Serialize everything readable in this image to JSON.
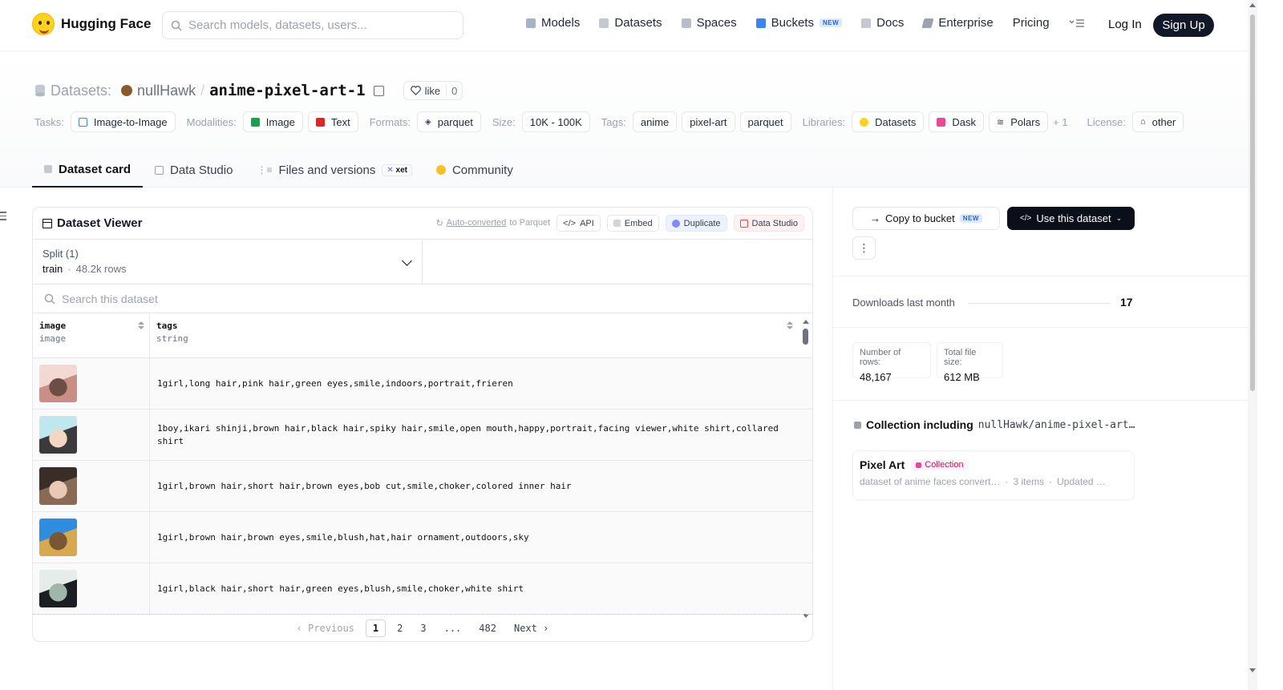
{
  "nav": {
    "brand": "Hugging Face",
    "search_placeholder": "Search models, datasets, users...",
    "links": [
      {
        "label": "Models",
        "icon": "models-icon"
      },
      {
        "label": "Datasets",
        "icon": "datasets-icon"
      },
      {
        "label": "Spaces",
        "icon": "spaces-icon"
      },
      {
        "label": "Buckets",
        "icon": "buckets-icon",
        "badge": "NEW"
      },
      {
        "label": "Docs",
        "icon": "docs-icon"
      },
      {
        "label": "Enterprise",
        "icon": "enterprise-icon"
      },
      {
        "label": "Pricing"
      }
    ],
    "login": "Log In",
    "signup": "Sign Up"
  },
  "header": {
    "prefix": "Datasets:",
    "owner": "nullHawk",
    "slash": "/",
    "repo": "anime-pixel-art-1",
    "like_label": "like",
    "like_count": "0"
  },
  "tags": {
    "tasks_label": "Tasks:",
    "tasks": [
      "Image-to-Image"
    ],
    "modalities_label": "Modalities:",
    "modalities": [
      "Image",
      "Text"
    ],
    "formats_label": "Formats:",
    "formats": [
      "parquet"
    ],
    "size_label": "Size:",
    "size": "10K - 100K",
    "tags_label": "Tags:",
    "tags": [
      "anime",
      "pixel-art",
      "parquet"
    ],
    "libraries_label": "Libraries:",
    "libraries": [
      "Datasets",
      "Dask",
      "Polars"
    ],
    "libraries_more": "+ 1",
    "license_label": "License:",
    "license": "other"
  },
  "tabs": [
    {
      "label": "Dataset card",
      "active": true
    },
    {
      "label": "Data Studio"
    },
    {
      "label": "Files and versions",
      "badge": "xet"
    },
    {
      "label": "Community"
    }
  ],
  "viewer": {
    "title": "Dataset Viewer",
    "auto_converted": "Auto-converted",
    "to_parquet": "to Parquet",
    "api": "API",
    "embed": "Embed",
    "duplicate": "Duplicate",
    "data_studio": "Data Studio",
    "split_label": "Split (1)",
    "split_value": "train",
    "split_rows": "48.2k rows",
    "search_placeholder": "Search this dataset",
    "columns": [
      {
        "name": "image",
        "type": "image"
      },
      {
        "name": "tags",
        "type": "string"
      }
    ],
    "rows": [
      {
        "tags": "1girl,long hair,pink hair,green eyes,smile,indoors,portrait,frieren",
        "thumb": [
          "#f3d9d4",
          "#c98f86",
          "#6b4f44"
        ]
      },
      {
        "tags": "1boy,ikari shinji,brown hair,black hair,spiky hair,smile,open mouth,happy,portrait,facing viewer,white shirt,collared shirt",
        "thumb": [
          "#bfe7ef",
          "#3b3b3b",
          "#f2d7c2"
        ]
      },
      {
        "tags": "1girl,brown hair,short hair,brown eyes,bob cut,smile,choker,colored inner hair",
        "thumb": [
          "#3a2d27",
          "#8a6a55",
          "#e8c9b5"
        ]
      },
      {
        "tags": "1girl,brown hair,brown eyes,smile,blush,hat,hair ornament,outdoors,sky",
        "thumb": [
          "#2f8de0",
          "#d8a84f",
          "#7a5733"
        ]
      },
      {
        "tags": "1girl,black hair,short hair,green eyes,blush,smile,choker,white shirt",
        "thumb": [
          "#e6ecea",
          "#1c1f22",
          "#9fb7a8"
        ]
      }
    ],
    "pagination": {
      "previous": "Previous",
      "pages": [
        "1",
        "2",
        "3",
        "...",
        "482"
      ],
      "current": "1",
      "next": "Next"
    }
  },
  "sidebar": {
    "copy_to_bucket": "Copy to bucket",
    "copy_badge": "NEW",
    "use_dataset": "Use this dataset",
    "downloads_label": "Downloads last month",
    "downloads_value": "17",
    "num_rows_label": "Number of rows:",
    "num_rows": "48,167",
    "file_size_label": "Total file size:",
    "file_size": "612 MB",
    "collection_heading": "Collection including",
    "collection_repo": "nullHawk/anime-pixel-art…",
    "collection_name": "Pixel Art",
    "collection_badge": "Collection",
    "collection_desc": "dataset of anime faces convert…",
    "collection_items": "3 items",
    "collection_updated": "Updated …"
  }
}
